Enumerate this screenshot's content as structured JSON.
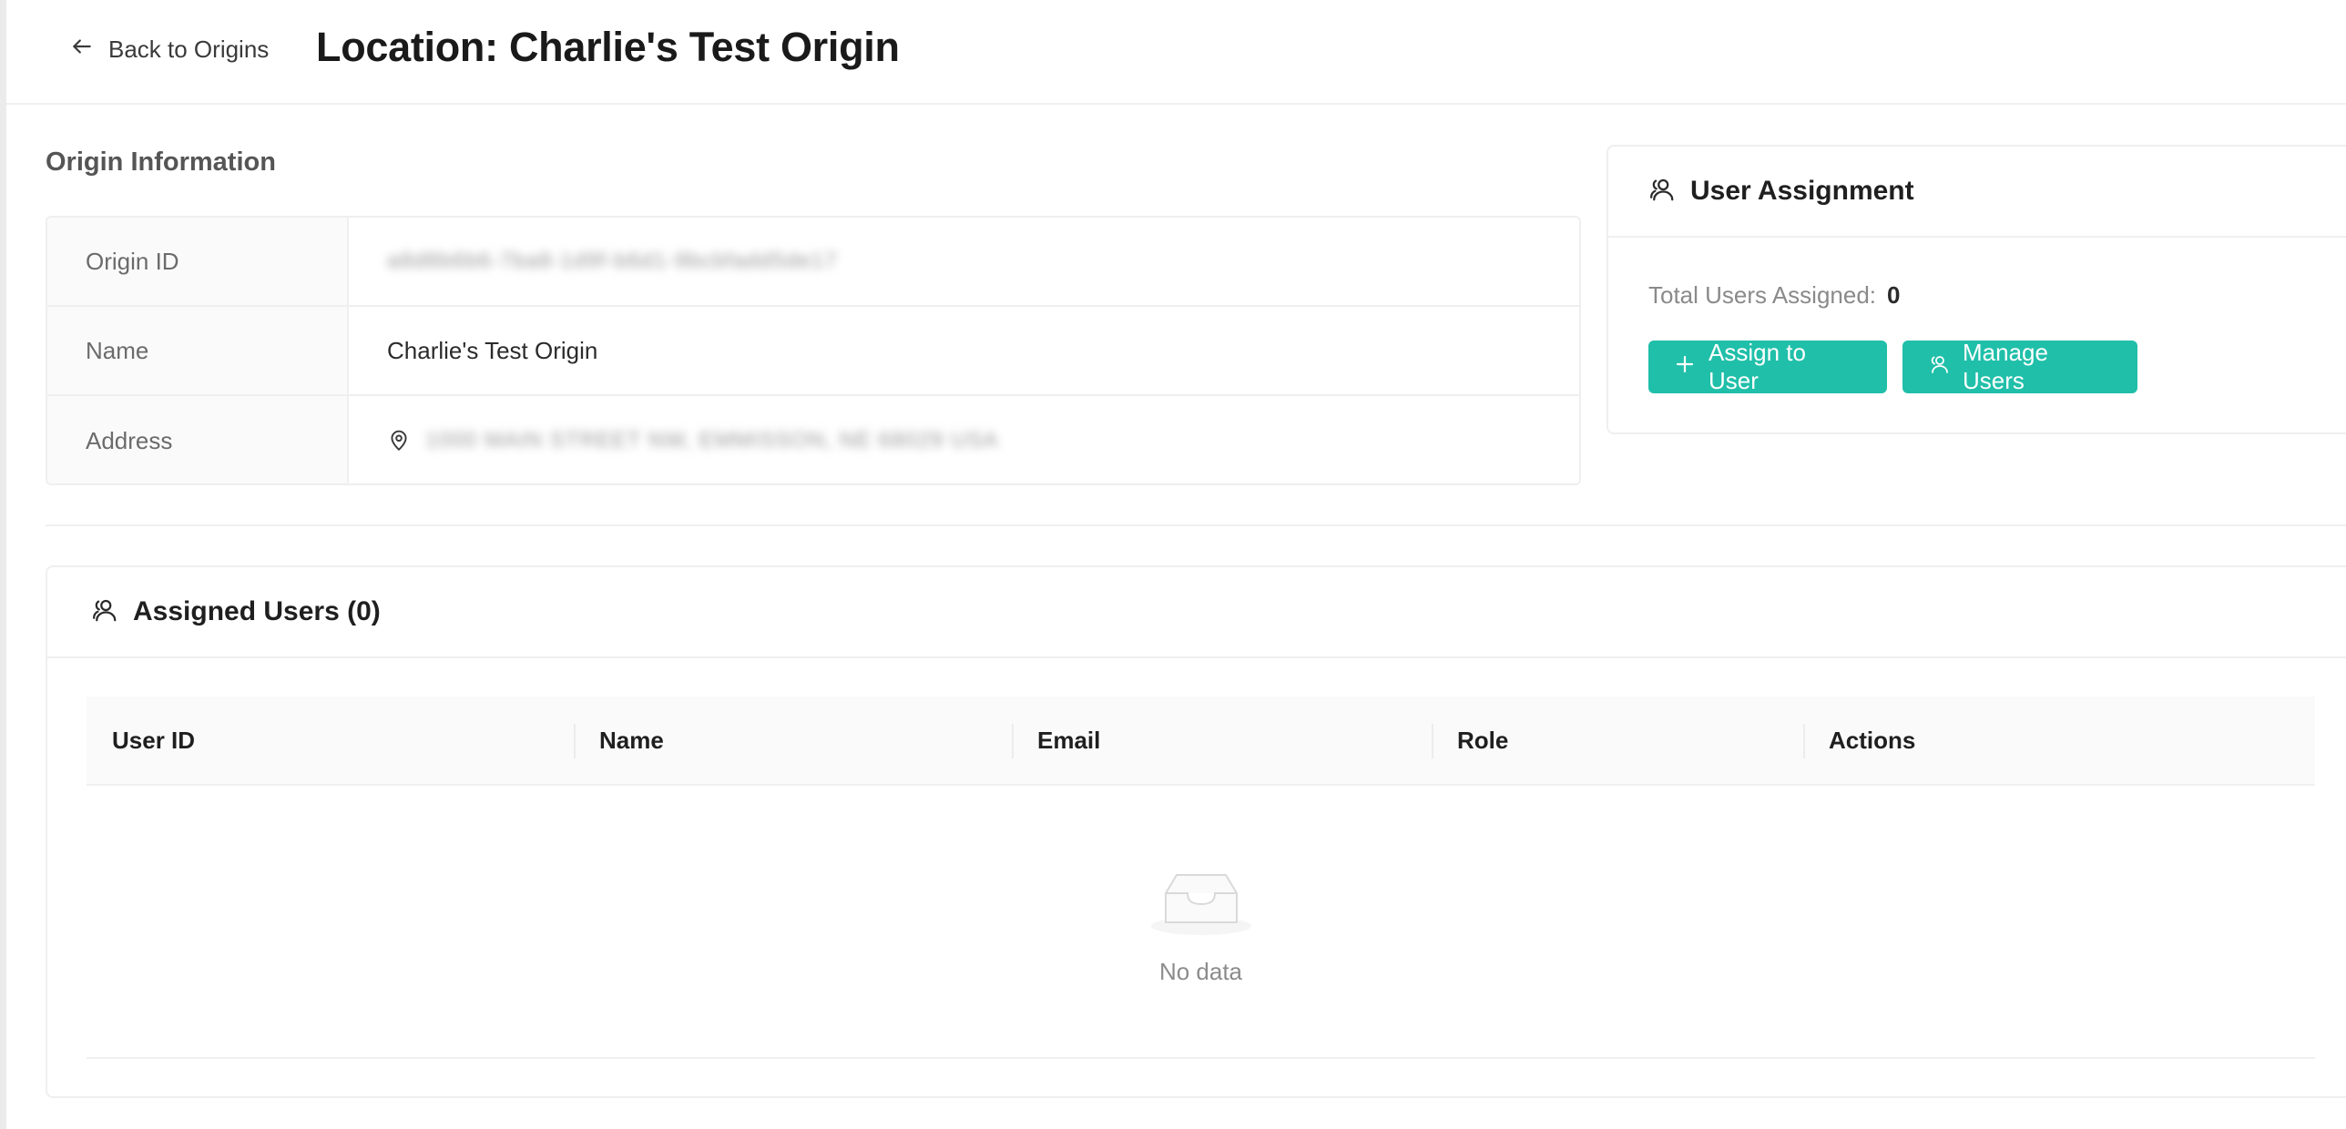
{
  "header": {
    "back_label": "Back to Origins",
    "title": "Location: Charlie's Test Origin"
  },
  "origin_info": {
    "section_title": "Origin Information",
    "rows": [
      {
        "label": "Origin ID",
        "value": "a8d8b6b6-7ba8-1d9f-b6d1-9bcbfadd5de17"
      },
      {
        "label": "Name",
        "value": "Charlie's Test Origin"
      },
      {
        "label": "Address",
        "value": "1000 MAIN STREET NW, EMMISSON, NE 68029 USA"
      }
    ]
  },
  "user_assignment": {
    "title": "User Assignment",
    "total_label": "Total Users Assigned:",
    "total_value": "0",
    "assign_button": "Assign to User",
    "manage_button": "Manage Users"
  },
  "assigned_users": {
    "title": "Assigned Users (0)",
    "columns": [
      "User ID",
      "Name",
      "Email",
      "Role",
      "Actions"
    ],
    "empty_text": "No data"
  },
  "colors": {
    "accent": "#20bfa9",
    "border": "#efefef",
    "label_bg": "#fafafa"
  },
  "icons": {
    "back": "arrow-left-icon",
    "pin": "map-pin-icon",
    "users": "users-icon",
    "plus": "plus-icon",
    "empty": "inbox-icon"
  }
}
